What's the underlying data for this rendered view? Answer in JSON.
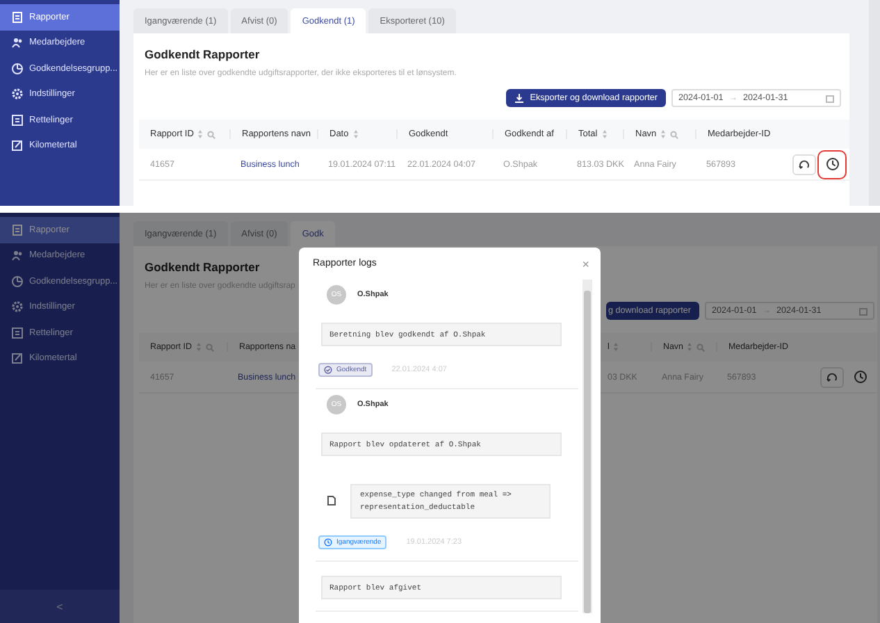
{
  "screens": [
    {
      "sidebar": {
        "items": [
          {
            "label": "Rapporter",
            "selected": true
          },
          {
            "label": "Medarbejdere",
            "selected": false
          },
          {
            "label": "Godkendelsesgrupp...",
            "selected": false
          },
          {
            "label": "Indstillinger",
            "selected": false
          },
          {
            "label": "Rettelinger",
            "selected": false
          },
          {
            "label": "Kilometertal",
            "selected": false
          }
        ]
      },
      "tabs": [
        {
          "label": "Igangværende (1)",
          "selected": false
        },
        {
          "label": "Afvist (0)",
          "selected": false
        },
        {
          "label": "Godkendt (1)",
          "selected": true
        },
        {
          "label": "Eksporteret (10)",
          "selected": false
        }
      ],
      "title": "Godkendt Rapporter",
      "description": "Her er en liste over godkendte udgiftsrapporter, der ikke eksporteres til et lønsystem.",
      "export_button": {
        "label": "Eksporter og download rapporter",
        "icon": true
      },
      "date_range": {
        "start": "2024-01-01",
        "separator": "→",
        "end": "2024-01-31"
      },
      "table": {
        "column_groups": [
          [
            {
              "label": "Rapport ID",
              "sortable": true,
              "searchable": true
            },
            {
              "label": "Rapportens navn",
              "sortable": false,
              "searchable": false
            },
            {
              "label": "Dato",
              "sortable": true,
              "searchable": false
            },
            {
              "label": "Godkendt",
              "sortable": false,
              "searchable": false
            },
            {
              "label": "Godkendt af",
              "sortable": false,
              "searchable": false
            },
            {
              "label": "Total",
              "sortable": true,
              "searchable": false
            },
            {
              "label": "Navn",
              "sortable": true,
              "searchable": true
            },
            {
              "label": "Medarbejder-ID",
              "sortable": false,
              "searchable": false
            }
          ]
        ],
        "rows": [
          {
            "cell_groups": [
              [
                "41657",
                "Business lunch",
                "19.01.2024 07:11",
                "22.01.2024 04:07",
                "O.Shpak",
                "813.03 DKK",
                "Anna Fairy",
                "567893"
              ]
            ],
            "history_highlighted": true
          }
        ]
      }
    },
    {
      "sidebar": {
        "items": [
          {
            "label": "Rapporter",
            "selected": true
          },
          {
            "label": "Medarbejdere",
            "selected": false
          },
          {
            "label": "Godkendelsesgrupp...",
            "selected": false
          },
          {
            "label": "Indstillinger",
            "selected": false
          },
          {
            "label": "Rettelinger",
            "selected": false
          },
          {
            "label": "Kilometertal",
            "selected": false
          }
        ],
        "collapse": "<"
      },
      "tabs": [
        {
          "label": "Igangværende (1)",
          "selected": false
        },
        {
          "label": "Afvist (0)",
          "selected": false
        },
        {
          "label": "Godk",
          "selected": true
        }
      ],
      "title": "Godkendt Rapporter",
      "description": "Her er en liste over godkendte udgiftsrap",
      "export_button": {
        "label": "g download rapporter",
        "icon": false
      },
      "date_range": {
        "start": "2024-01-01",
        "separator": "→",
        "end": "2024-01-31"
      },
      "table": {
        "column_groups": [
          [
            {
              "label": "Rapport ID",
              "sortable": true,
              "searchable": true
            },
            {
              "label": "Rapportens na"
            }
          ],
          [
            {
              "label": "l",
              "sortable": true,
              "searchable": false
            },
            {
              "label": "Navn",
              "sortable": true,
              "searchable": true
            },
            {
              "label": "Medarbejder-ID"
            }
          ]
        ],
        "rows": [
          {
            "cell_groups": [
              [
                "41657",
                "Business lunch"
              ],
              [
                "03 DKK",
                "Anna Fairy",
                "567893"
              ]
            ],
            "history_highlighted": false
          }
        ]
      },
      "dialog": {
        "title": "Rapporter logs",
        "close": "×",
        "entries": [
          {
            "avatar": "OS",
            "user": "O.Shpak",
            "message": "Beretning blev godkendt af O.Shpak",
            "status": {
              "kind": "approved",
              "label": "Godkendt"
            },
            "time": "22.01.2024 4:07"
          },
          {
            "avatar": "OS",
            "user": "O.Shpak",
            "message": "Rapport blev opdateret af O.Shpak",
            "change": "expense_type changed from meal => representation_deductable",
            "status": {
              "kind": "in_progress",
              "label": "Igangværende"
            },
            "time": "19.01.2024 7:23"
          },
          {
            "message": "Rapport blev afgivet"
          }
        ]
      }
    }
  ]
}
